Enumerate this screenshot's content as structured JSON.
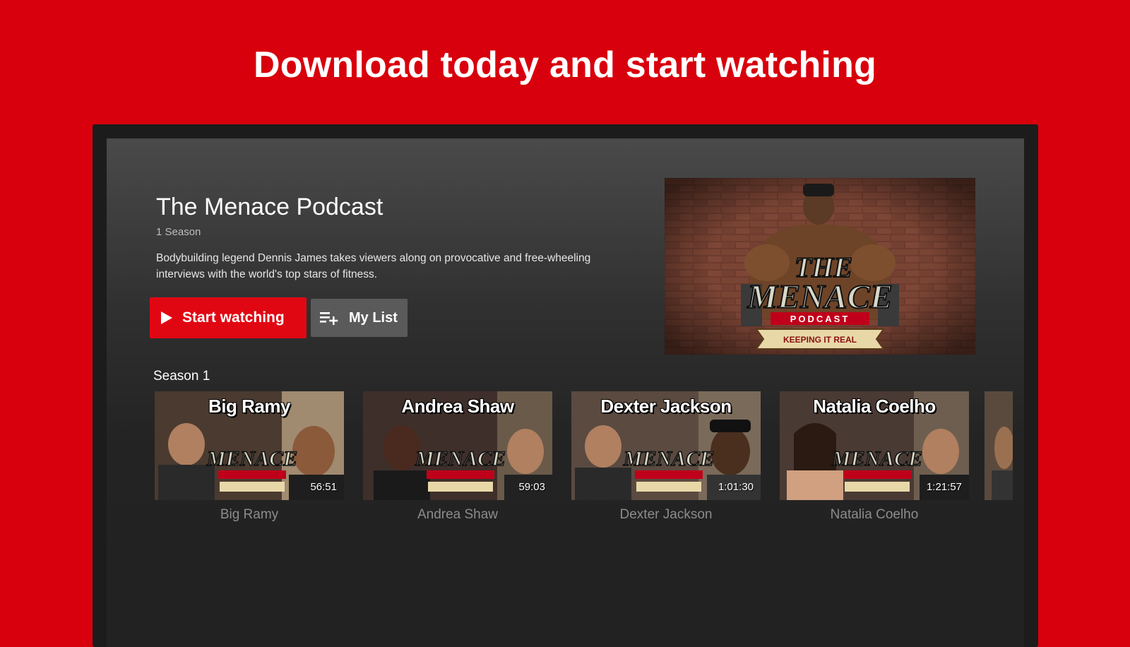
{
  "banner": {
    "headline": "Download today and start watching"
  },
  "show": {
    "title": "The Menace Podcast",
    "meta": "1 Season",
    "description": "Bodybuilding legend Dennis James takes viewers along on provocative and free-wheeling interviews with the world's top stars of fitness.",
    "start_label": "Start watching",
    "mylist_label": "My List",
    "hero_logo_line1": "THE",
    "hero_logo_line2": "MENACE",
    "hero_logo_line3": "PODCAST",
    "hero_ribbon": "KEEPING IT REAL"
  },
  "season": {
    "label": "Season 1",
    "episodes": [
      {
        "title": "Big Ramy",
        "name": "Big Ramy",
        "duration": "56:51"
      },
      {
        "title": "Andrea Shaw",
        "name": "Andrea Shaw",
        "duration": "59:03"
      },
      {
        "title": "Dexter Jackson",
        "name": "Dexter Jackson",
        "duration": "1:01:30"
      },
      {
        "title": "Natalia Coelho",
        "name": "Natalia Coelho",
        "duration": "1:21:57"
      }
    ]
  },
  "colors": {
    "brand_red": "#d8000c",
    "button_red": "#e10712"
  },
  "icons": {
    "play": "play-icon",
    "add_to_list": "playlist-add-icon"
  }
}
